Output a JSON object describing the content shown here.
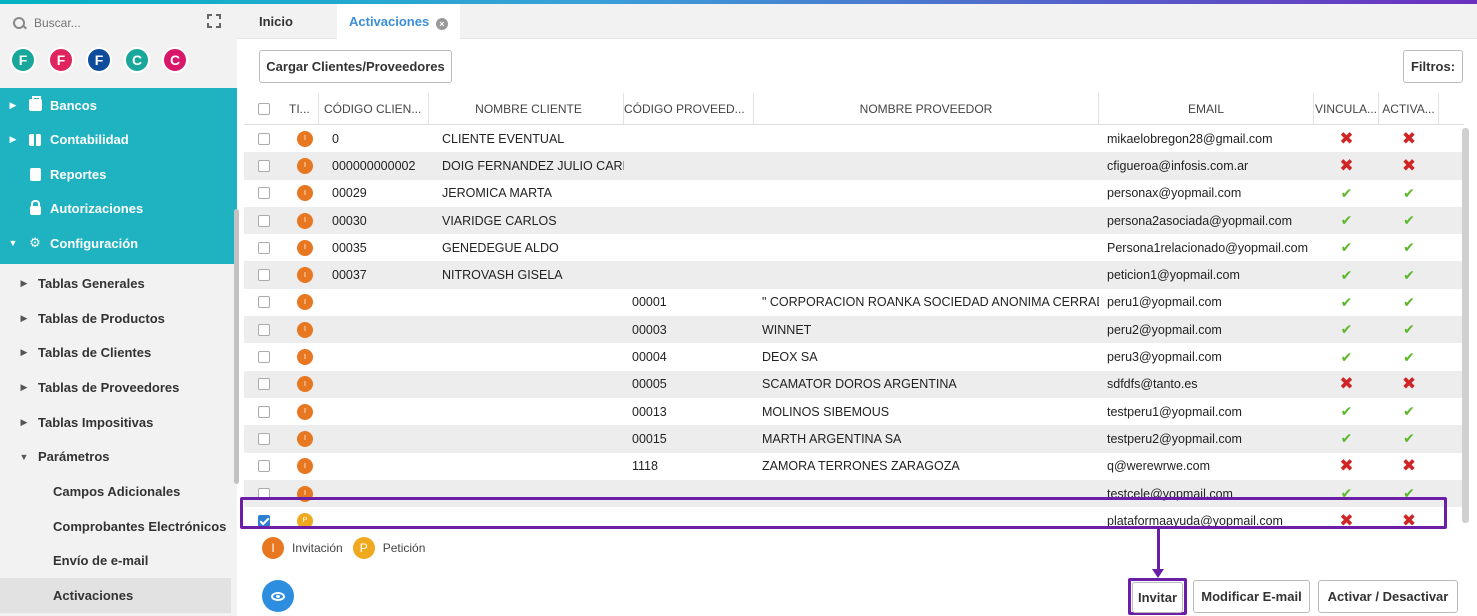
{
  "search": {
    "placeholder": "Buscar..."
  },
  "avatars": [
    {
      "letter": "F",
      "color": "#1aa79b"
    },
    {
      "letter": "F",
      "color": "#e0245e"
    },
    {
      "letter": "F",
      "color": "#0f4c9c"
    },
    {
      "letter": "C",
      "color": "#1aa79b"
    },
    {
      "letter": "C",
      "color": "#d8166a"
    }
  ],
  "menu_main": [
    {
      "label": "Bancos",
      "arrow": "▶",
      "icon": "briefcase-icon"
    },
    {
      "label": "Contabilidad",
      "arrow": "▶",
      "icon": "book-icon"
    },
    {
      "label": "Reportes",
      "arrow": "",
      "icon": "report-icon"
    },
    {
      "label": "Autorizaciones",
      "arrow": "",
      "icon": "lock-icon"
    },
    {
      "label": "Configuración",
      "arrow": "▼",
      "icon": "gears-icon"
    }
  ],
  "menu_sub": [
    {
      "label": "Tablas Generales",
      "arrow": "▶"
    },
    {
      "label": "Tablas de Productos",
      "arrow": "▶"
    },
    {
      "label": "Tablas de Clientes",
      "arrow": "▶"
    },
    {
      "label": "Tablas de Proveedores",
      "arrow": "▶"
    },
    {
      "label": "Tablas Impositivas",
      "arrow": "▶"
    },
    {
      "label": "Parámetros",
      "arrow": "▼"
    }
  ],
  "menu_leaf": [
    "Campos Adicionales",
    "Comprobantes Electrónicos",
    "Envío de e-mail",
    "Activaciones"
  ],
  "tabs": {
    "inicio": "Inicio",
    "activaciones": "Activaciones"
  },
  "toolbar": {
    "cargar": "Cargar Clientes/Proveedores",
    "filtros": "Filtros:"
  },
  "columns": {
    "ti": "TI...",
    "codigo_cliente": "CÓDIGO CLIEN...",
    "nombre_cliente": "NOMBRE CLIENTE",
    "codigo_proveedor": "CÓDIGO PROVEED...",
    "nombre_proveedor": "NOMBRE PROVEEDOR",
    "email": "EMAIL",
    "vinculado": "VINCULA...",
    "activado": "ACTIVA..."
  },
  "rows": [
    {
      "type": "I",
      "cod_cli": "0",
      "nom_cli": "CLIENTE EVENTUAL",
      "cod_prov": "",
      "nom_prov": "",
      "email": "mikaelobregon28@gmail.com",
      "vinc": false,
      "act": false,
      "checked": false
    },
    {
      "type": "I",
      "cod_cli": "000000000002",
      "nom_cli": "DOIG FERNANDEZ JULIO CARLOS",
      "cod_prov": "",
      "nom_prov": "",
      "email": "cfigueroa@infosis.com.ar",
      "vinc": false,
      "act": false,
      "checked": false
    },
    {
      "type": "I",
      "cod_cli": "00029",
      "nom_cli": "JEROMICA MARTA",
      "cod_prov": "",
      "nom_prov": "",
      "email": "personax@yopmail.com",
      "vinc": true,
      "act": true,
      "checked": false
    },
    {
      "type": "I",
      "cod_cli": "00030",
      "nom_cli": "VIARIDGE CARLOS",
      "cod_prov": "",
      "nom_prov": "",
      "email": "persona2asociada@yopmail.com",
      "vinc": true,
      "act": true,
      "checked": false
    },
    {
      "type": "I",
      "cod_cli": "00035",
      "nom_cli": "GENEDEGUE ALDO",
      "cod_prov": "",
      "nom_prov": "",
      "email": "Persona1relacionado@yopmail.com",
      "vinc": true,
      "act": true,
      "checked": false
    },
    {
      "type": "I",
      "cod_cli": "00037",
      "nom_cli": "NITROVASH GISELA",
      "cod_prov": "",
      "nom_prov": "",
      "email": "peticion1@yopmail.com",
      "vinc": true,
      "act": true,
      "checked": false
    },
    {
      "type": "I",
      "cod_cli": "",
      "nom_cli": "",
      "cod_prov": "00001",
      "nom_prov": "\" CORPORACION ROANKA SOCIEDAD ANONIMA CERRADA \"",
      "email": "peru1@yopmail.com",
      "vinc": true,
      "act": true,
      "checked": false
    },
    {
      "type": "I",
      "cod_cli": "",
      "nom_cli": "",
      "cod_prov": "00003",
      "nom_prov": "WINNET",
      "email": "peru2@yopmail.com",
      "vinc": true,
      "act": true,
      "checked": false
    },
    {
      "type": "I",
      "cod_cli": "",
      "nom_cli": "",
      "cod_prov": "00004",
      "nom_prov": "DEOX SA",
      "email": "peru3@yopmail.com",
      "vinc": true,
      "act": true,
      "checked": false
    },
    {
      "type": "I",
      "cod_cli": "",
      "nom_cli": "",
      "cod_prov": "00005",
      "nom_prov": "SCAMATOR DOROS ARGENTINA",
      "email": "sdfdfs@tanto.es",
      "vinc": false,
      "act": false,
      "checked": false
    },
    {
      "type": "I",
      "cod_cli": "",
      "nom_cli": "",
      "cod_prov": "00013",
      "nom_prov": "MOLINOS SIBEMOUS",
      "email": "testperu1@yopmail.com",
      "vinc": true,
      "act": true,
      "checked": false
    },
    {
      "type": "I",
      "cod_cli": "",
      "nom_cli": "",
      "cod_prov": "00015",
      "nom_prov": "MARTH ARGENTINA SA",
      "email": "testperu2@yopmail.com",
      "vinc": true,
      "act": true,
      "checked": false
    },
    {
      "type": "I",
      "cod_cli": "",
      "nom_cli": "",
      "cod_prov": "1118",
      "nom_prov": "ZAMORA TERRONES ZARAGOZA",
      "email": "q@werewrwe.com",
      "vinc": false,
      "act": false,
      "checked": false
    },
    {
      "type": "I",
      "cod_cli": "",
      "nom_cli": "",
      "cod_prov": "",
      "nom_prov": "",
      "email": "testcele@yopmail.com",
      "vinc": true,
      "act": true,
      "checked": false
    },
    {
      "type": "P",
      "cod_cli": "",
      "nom_cli": "",
      "cod_prov": "",
      "nom_prov": "",
      "email": "plataformaayuda@yopmail.com",
      "vinc": false,
      "act": false,
      "checked": true
    }
  ],
  "legend": {
    "inv_letter": "I",
    "inv_label": "Invitación",
    "pet_letter": "P",
    "pet_label": "Petición"
  },
  "actions": {
    "invitar": "Invitar",
    "modificar": "Modificar E-mail",
    "activar": "Activar / Desactivar"
  },
  "colors": {
    "teal": "#1fb3c2",
    "invitacion": "#e87722",
    "peticion": "#f0a81e",
    "highlight": "#6a1fa6",
    "ok": "#5cb82a",
    "error": "#d02525"
  }
}
